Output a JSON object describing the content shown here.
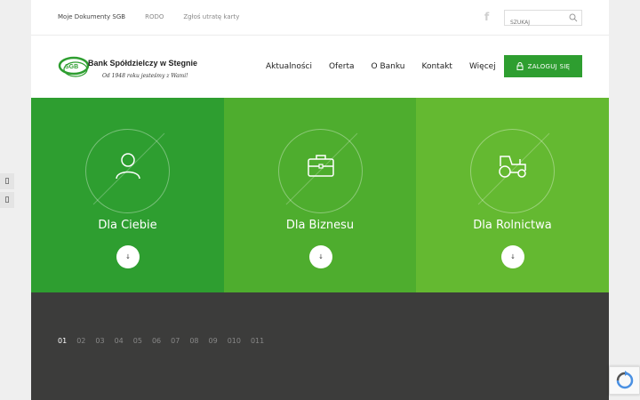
{
  "topbar": {
    "links": [
      "Moje Dokumenty SGB",
      "RODO",
      "Zgłoś utratę karty"
    ],
    "search_placeholder": "SZUKAJ"
  },
  "header": {
    "logo_badge": "SGB",
    "logo_name": "Bank Spółdzielczy w Stegnie",
    "logo_tagline": "Od 1948 roku jesteśmy z Wami!",
    "nav": [
      "Aktualności",
      "Oferta",
      "O Banku",
      "Kontakt",
      "Więcej"
    ],
    "login_label": "ZALOGUJ SIĘ"
  },
  "tiles": [
    {
      "title": "Dla Ciebie",
      "icon": "user-icon",
      "color": "#2e9e30"
    },
    {
      "title": "Dla Biznesu",
      "icon": "briefcase-icon",
      "color": "#4ead2e"
    },
    {
      "title": "Dla Rolnictwa",
      "icon": "tractor-icon",
      "color": "#64b931"
    }
  ],
  "slider": {
    "pages": [
      "01",
      "02",
      "03",
      "04",
      "05",
      "06",
      "07",
      "08",
      "09",
      "010",
      "011"
    ],
    "active": "01"
  },
  "colors": {
    "accent": "#2e9e30",
    "dark": "#3c3c3b"
  }
}
